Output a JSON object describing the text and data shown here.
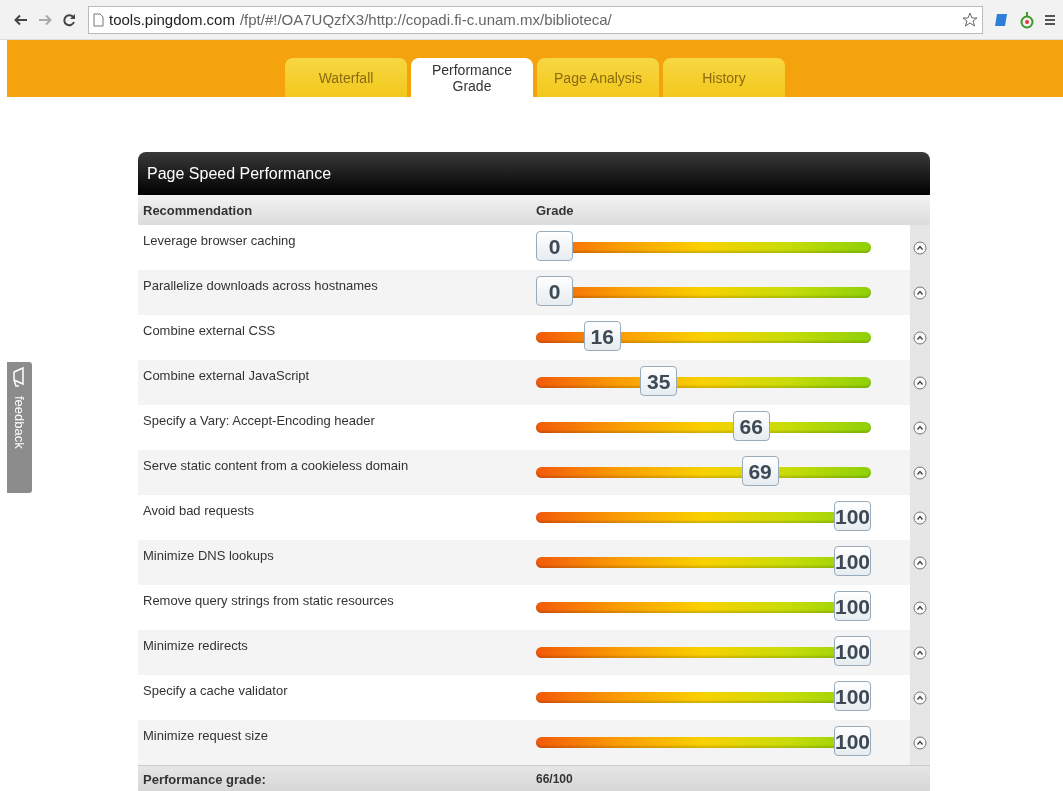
{
  "browser": {
    "url_host": "tools.pingdom.com",
    "url_path": "/fpt/#!/OA7UQzfX3/http://copadi.fi-c.unam.mx/biblioteca/"
  },
  "tabs": [
    {
      "label": "Waterfall",
      "selected": false
    },
    {
      "label": "Performance Grade",
      "selected": true
    },
    {
      "label": "Page Analysis",
      "selected": false
    },
    {
      "label": "History",
      "selected": false
    }
  ],
  "feedback": {
    "label": "feedback"
  },
  "panel": {
    "title": "Page Speed Performance",
    "columns": [
      "Recommendation",
      "Grade"
    ],
    "rows": [
      {
        "name": "Leverage browser caching",
        "grade": "0",
        "level": 0
      },
      {
        "name": "Parallelize downloads across hostnames",
        "grade": "0",
        "level": 0
      },
      {
        "name": "Combine external CSS",
        "grade": "16",
        "level": 0.16
      },
      {
        "name": "Combine external JavaScript",
        "grade": "35",
        "level": 0.35
      },
      {
        "name": "Specify a Vary: Accept-Encoding header",
        "grade": "66",
        "level": 0.66
      },
      {
        "name": "Serve static content from a cookieless domain",
        "grade": "69",
        "level": 0.69
      },
      {
        "name": "Avoid bad requests",
        "grade": "100",
        "level": 1
      },
      {
        "name": "Minimize DNS lookups",
        "grade": "100",
        "level": 1
      },
      {
        "name": "Remove query strings from static resources",
        "grade": "100",
        "level": 1
      },
      {
        "name": "Minimize redirects",
        "grade": "100",
        "level": 1
      },
      {
        "name": "Specify a cache validator",
        "grade": "100",
        "level": 1
      },
      {
        "name": "Minimize request size",
        "grade": "100",
        "level": 1
      }
    ],
    "footer": {
      "label": "Performance grade:",
      "value": "66/100"
    }
  }
}
